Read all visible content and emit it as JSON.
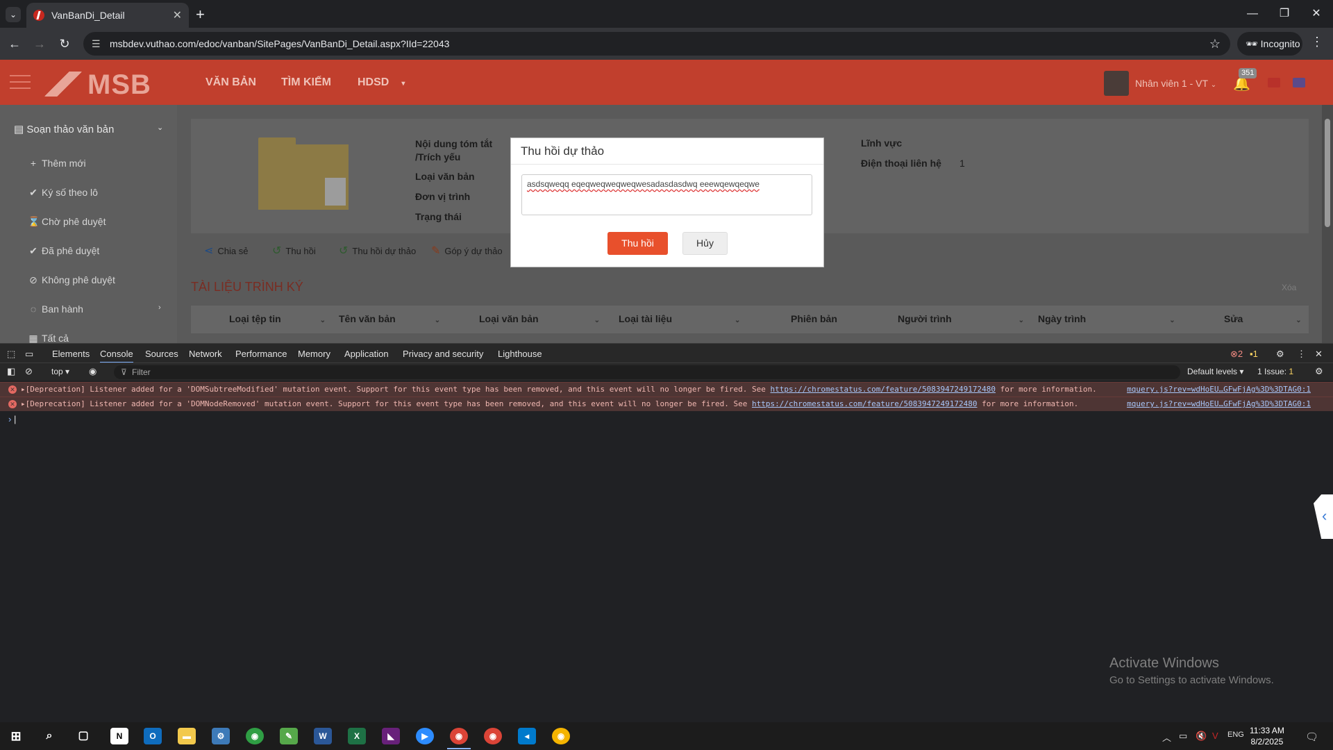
{
  "browser": {
    "tab_title": "VanBanDi_Detail",
    "url": "msbdev.vuthao.com/edoc/vanban/SitePages/VanBanDi_Detail.aspx?IId=22043",
    "incognito_label": "Incognito"
  },
  "app": {
    "logo": "MSB",
    "nav": [
      "VĂN BẢN",
      "TÌM KIẾM",
      "HDSD"
    ],
    "user_name": "Nhân viên 1 - VT",
    "notification_count": "351"
  },
  "sidebar": {
    "group_label": "Soạn thảo văn bản",
    "items": [
      {
        "label": "Thêm mới",
        "icon": "plus-icon"
      },
      {
        "label": "Ký số theo lô",
        "icon": "check-circle-icon"
      },
      {
        "label": "Chờ phê duyệt",
        "icon": "hourglass-icon"
      },
      {
        "label": "Đã phê duyệt",
        "icon": "check-circle-icon"
      },
      {
        "label": "Không phê duyệt",
        "icon": "ban-icon"
      },
      {
        "label": "Ban hành",
        "icon": "check-outline-icon"
      },
      {
        "label": "Tất cả",
        "icon": "stack-icon"
      }
    ]
  },
  "detail": {
    "summary_label": "Nội dung tóm tắt /Trích yếu",
    "doc_type_label": "Loại văn bản",
    "submitting_unit_label": "Đơn vị trình",
    "status_label": "Trạng thái",
    "field_label": "Lĩnh vực",
    "phone_label": "Điện thoại liên hệ",
    "phone_value": "1"
  },
  "actions": [
    "Chia sẻ",
    "Thu hồi",
    "Thu hồi dự thảo",
    "Góp ý dự thảo"
  ],
  "section_title": "TÀI LIỆU TRÌNH KÝ",
  "delete_label": "Xóa",
  "table_headers": [
    "Loại tệp tin",
    "Tên văn bản",
    "Loại văn bản",
    "Loại tài liệu",
    "Phiên bản",
    "Người trình",
    "Ngày trình",
    "Sửa"
  ],
  "modal": {
    "title": "Thu hồi dự thảo",
    "textarea_value": "asdsqweqq eqeqweqweqweqwesadasdasdwq eeewqewqeqwe",
    "confirm_label": "Thu hồi",
    "cancel_label": "Hủy"
  },
  "devtools": {
    "tabs": [
      "Elements",
      "Console",
      "Sources",
      "Network",
      "Performance",
      "Memory",
      "Application",
      "Privacy and security",
      "Lighthouse"
    ],
    "active_tab": "Console",
    "error_count": "2",
    "warning_count": "1",
    "context": "top",
    "filter_placeholder": "Filter",
    "levels": "Default levels",
    "issues": "1 Issue:",
    "issues_count": "1",
    "messages": [
      {
        "text": "▸[Deprecation] Listener added for a 'DOMSubtreeModified' mutation event. Support for this event type has been removed, and this event will no longer be fired. See",
        "link": "https://chromestatus.com/feature/5083947249172480",
        "suffix": "for more information.",
        "source": "mquery.js?rev=wdHoEU…GFwFjAg%3D%3DTAG0:1"
      },
      {
        "text": "▸[Deprecation] Listener added for a 'DOMNodeRemoved' mutation event. Support for this event type has been removed, and this event will no longer be fired. See",
        "link": "https://chromestatus.com/feature/5083947249172480",
        "suffix": "for more information.",
        "source": "mquery.js?rev=wdHoEU…GFwFjAg%3D%3DTAG0:1"
      }
    ]
  },
  "watermark": {
    "line1": "Activate Windows",
    "line2": "Go to Settings to activate Windows."
  },
  "taskbar": {
    "lang": "ENG",
    "time": "11:33 AM",
    "date": "8/2/2025"
  },
  "colors": {
    "header": "#c13f2d",
    "primary_button": "#e8502c",
    "section_title": "#7a2c22"
  }
}
